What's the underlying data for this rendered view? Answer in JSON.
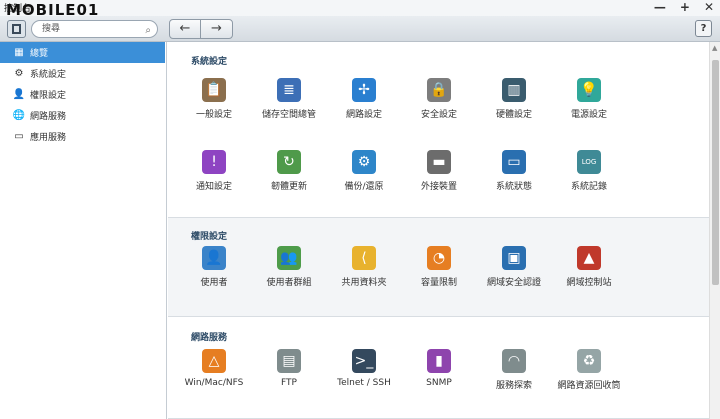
{
  "window": {
    "title": "控制台",
    "watermark": "MOBILE01"
  },
  "window_controls": {
    "minimize": "—",
    "maximize": "+",
    "close": "✕"
  },
  "toolbar": {
    "search_placeholder": "搜尋",
    "back": "←",
    "forward": "→",
    "help": "?"
  },
  "sidebar": {
    "items": [
      {
        "label": "總覽",
        "icon": "grid-icon",
        "glyph": "▦"
      },
      {
        "label": "系統設定",
        "icon": "gear-icon",
        "glyph": "⚙"
      },
      {
        "label": "權限設定",
        "icon": "user-icon",
        "glyph": "👤"
      },
      {
        "label": "網路服務",
        "icon": "globe-icon",
        "glyph": "🌐"
      },
      {
        "label": "應用服務",
        "icon": "apps-icon",
        "glyph": "▭"
      }
    ]
  },
  "sections": [
    {
      "title": "系統設定",
      "apps": [
        {
          "label": "一般設定",
          "icon": "clipboard-gear-icon",
          "color": "#8b6f4e",
          "glyph": "📋"
        },
        {
          "label": "儲存空間總管",
          "icon": "database-icon",
          "color": "#3d6fb6",
          "glyph": "≣"
        },
        {
          "label": "網路設定",
          "icon": "network-icon",
          "color": "#2a7fd0",
          "glyph": "✢"
        },
        {
          "label": "安全設定",
          "icon": "lock-icon",
          "color": "#7d7d7d",
          "glyph": "🔒"
        },
        {
          "label": "硬體設定",
          "icon": "server-icon",
          "color": "#3a5c6e",
          "glyph": "▥"
        },
        {
          "label": "電源設定",
          "icon": "bulb-icon",
          "color": "#30a89a",
          "glyph": "💡"
        },
        {
          "label": "通知設定",
          "icon": "chat-alert-icon",
          "color": "#8e44c2",
          "glyph": "!"
        },
        {
          "label": "韌體更新",
          "icon": "chip-refresh-icon",
          "color": "#4f9a4a",
          "glyph": "↻"
        },
        {
          "label": "備份/還原",
          "icon": "backup-gear-icon",
          "color": "#2e86c9",
          "glyph": "⚙"
        },
        {
          "label": "外接裝置",
          "icon": "drive-icon",
          "color": "#6c6c6c",
          "glyph": "▬"
        },
        {
          "label": "系統狀態",
          "icon": "monitor-icon",
          "color": "#2a6fb0",
          "glyph": "▭"
        },
        {
          "label": "系統記錄",
          "icon": "log-file-icon",
          "color": "#3f8a96",
          "glyph": "LOG"
        }
      ]
    },
    {
      "title": "權限設定",
      "apps": [
        {
          "label": "使用者",
          "icon": "user-icon",
          "color": "#3a83c9",
          "glyph": "👤"
        },
        {
          "label": "使用者群組",
          "icon": "user-group-icon",
          "color": "#4e9c4a",
          "glyph": "👥"
        },
        {
          "label": "共用資料夾",
          "icon": "shared-folder-icon",
          "color": "#e8b22e",
          "glyph": "⟨"
        },
        {
          "label": "容量限制",
          "icon": "pie-chart-icon",
          "color": "#e67e22",
          "glyph": "◔"
        },
        {
          "label": "網域安全認證",
          "icon": "domain-auth-icon",
          "color": "#2a6fb0",
          "glyph": "▣"
        },
        {
          "label": "網域控制站",
          "icon": "domain-controller-icon",
          "color": "#c0392b",
          "glyph": "▲"
        }
      ]
    },
    {
      "title": "網路服務",
      "apps": [
        {
          "label": "Win/Mac/NFS",
          "icon": "triangle-network-icon",
          "color": "#e67e22",
          "glyph": "△"
        },
        {
          "label": "FTP",
          "icon": "ftp-folder-icon",
          "color": "#7f8c8d",
          "glyph": "▤"
        },
        {
          "label": "Telnet / SSH",
          "icon": "terminal-icon",
          "color": "#34495e",
          "glyph": ">_"
        },
        {
          "label": "SNMP",
          "icon": "bar-chart-icon",
          "color": "#8e44ad",
          "glyph": "▮"
        },
        {
          "label": "服務探索",
          "icon": "satellite-dish-icon",
          "color": "#7f8c8d",
          "glyph": "◠"
        },
        {
          "label": "網路資源回收筒",
          "icon": "recycle-bin-icon",
          "color": "#95a5a6",
          "glyph": "♻"
        }
      ]
    }
  ]
}
